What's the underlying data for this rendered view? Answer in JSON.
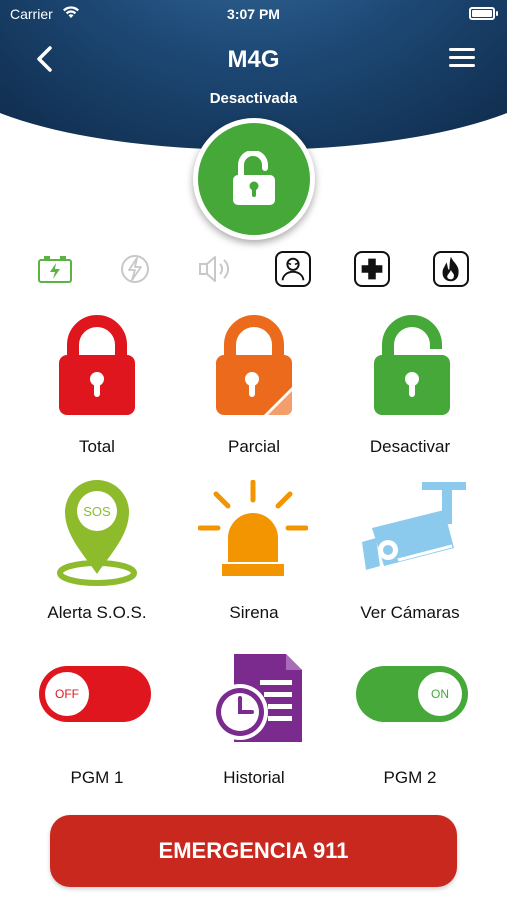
{
  "statusbar": {
    "carrier": "Carrier",
    "time": "3:07 PM"
  },
  "header": {
    "title": "M4G",
    "subtitle": "Desactivada"
  },
  "colors": {
    "header_dark": "#0b2340",
    "green": "#45a839",
    "red": "#e0161f",
    "orange": "#ec6a1c",
    "lime": "#8dbb2b",
    "amber": "#f39500",
    "light_blue": "#8ccaed",
    "purple": "#7b2a8e",
    "emergency": "#c9281f"
  },
  "status_icons": [
    "battery-icon",
    "power-icon",
    "speaker-icon",
    "user-icon",
    "medical-cross-icon",
    "fire-icon"
  ],
  "grid": [
    {
      "label": "Total",
      "icon": "lock-closed-icon"
    },
    {
      "label": "Parcial",
      "icon": "lock-partial-icon"
    },
    {
      "label": "Desactivar",
      "icon": "lock-open-icon"
    },
    {
      "label": "Alerta S.O.S.",
      "icon": "sos-pin-icon",
      "badge": "SOS"
    },
    {
      "label": "Sirena",
      "icon": "siren-icon"
    },
    {
      "label": "Ver Cámaras",
      "icon": "camera-icon"
    },
    {
      "label": "PGM 1",
      "icon": "toggle-off",
      "state": "OFF"
    },
    {
      "label": "Historial",
      "icon": "history-icon"
    },
    {
      "label": "PGM 2",
      "icon": "toggle-on",
      "state": "ON"
    }
  ],
  "emergency_button": {
    "label": "EMERGENCIA 911"
  }
}
